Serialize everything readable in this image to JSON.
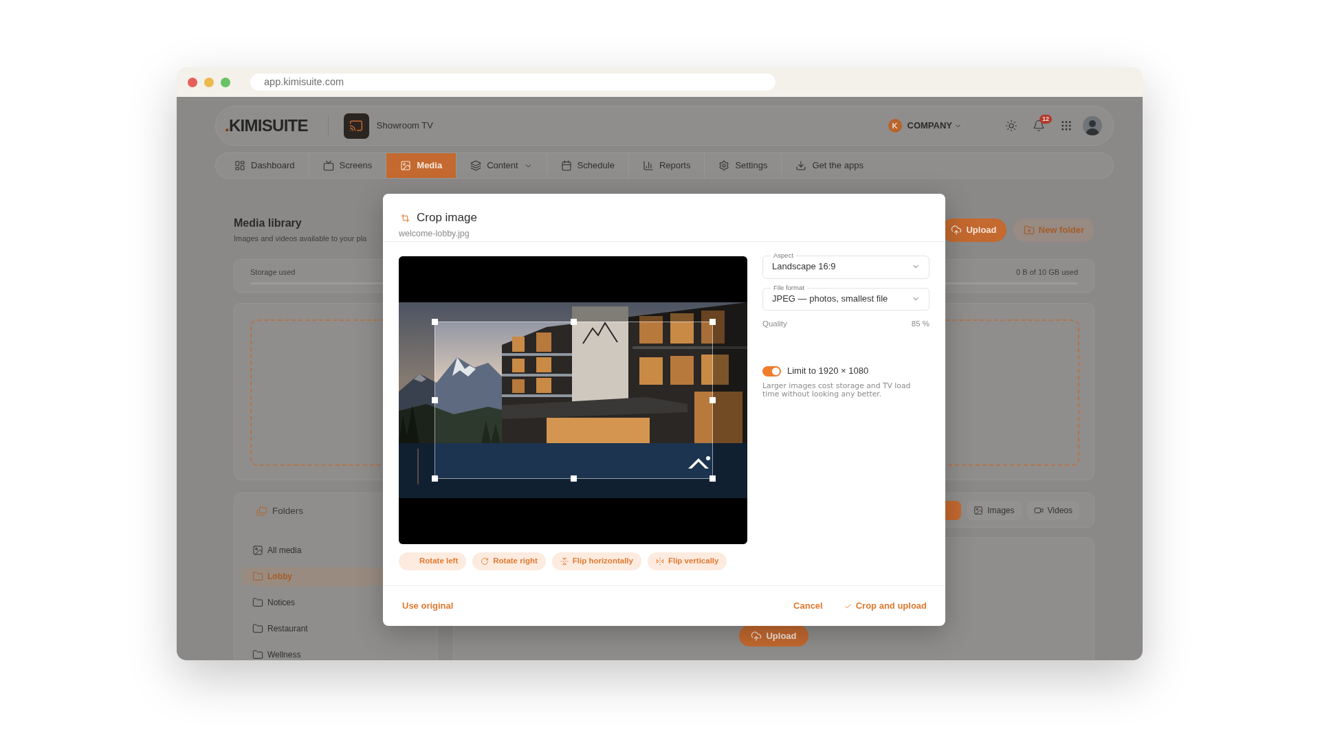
{
  "browser": {
    "url": "app.kimisuite.com"
  },
  "header": {
    "logo": {
      "mark": ".",
      "text": "KIMISUITE"
    },
    "screen": "Showroom TV",
    "company": {
      "initial": "K",
      "name": "COMPANY"
    },
    "notifications": "12"
  },
  "nav": [
    {
      "label": "Dashboard",
      "selected": false,
      "menu": false
    },
    {
      "label": "Screens",
      "selected": false,
      "menu": false
    },
    {
      "label": "Media",
      "selected": true,
      "menu": false
    },
    {
      "label": "Content",
      "selected": false,
      "menu": true
    },
    {
      "label": "Schedule",
      "selected": false,
      "menu": false
    },
    {
      "label": "Reports",
      "selected": false,
      "menu": false
    },
    {
      "label": "Settings",
      "selected": false,
      "menu": false
    },
    {
      "label": "Get the apps",
      "selected": false,
      "menu": false
    }
  ],
  "library": {
    "title": "Media library",
    "subtitle": "Images and videos available to your pla",
    "actions": [
      {
        "label": "Upload",
        "kind": "primary"
      },
      {
        "label": "New folder",
        "kind": "secondary"
      }
    ],
    "storage": {
      "label": "Storage used",
      "reading": "0 B of 10 GB used"
    },
    "folders": {
      "title": "Folders",
      "items": [
        {
          "label": "All media",
          "kind": "library",
          "selected": false
        },
        {
          "label": "Lobby",
          "kind": "folder",
          "selected": true
        },
        {
          "label": "Notices",
          "kind": "folder",
          "selected": false
        },
        {
          "label": "Restaurant",
          "kind": "folder",
          "selected": false
        },
        {
          "label": "Wellness",
          "kind": "folder",
          "selected": false
        }
      ]
    },
    "filters": [
      {
        "kind": "all",
        "selected": true
      },
      {
        "label": "Images",
        "kind": "images",
        "selected": false
      },
      {
        "label": "Videos",
        "kind": "videos",
        "selected": false
      }
    ],
    "empty_action": "Upload"
  },
  "dialog": {
    "title": "Crop image",
    "filename": "welcome-lobby.jpg",
    "tools": [
      {
        "label": "Rotate left",
        "kind": "rotate-left"
      },
      {
        "label": "Rotate right",
        "kind": "rotate-right"
      },
      {
        "label": "Flip horizontally",
        "kind": "flip-horizontal"
      },
      {
        "label": "Flip vertically",
        "kind": "flip-vertical"
      }
    ],
    "aspect": {
      "label": "Aspect",
      "value": "Landscape 16:9"
    },
    "format": {
      "label": "File format",
      "value": "JPEG — photos, smallest file"
    },
    "quality": {
      "label": "Quality",
      "reading": "85 %"
    },
    "limit": {
      "label": "Limit to 1920 × 1080",
      "on": true,
      "hint": "Larger images cost storage and TV load time without looking any better."
    },
    "footer": {
      "use_original": "Use original",
      "cancel": "Cancel",
      "confirm": "Crop and upload"
    }
  }
}
